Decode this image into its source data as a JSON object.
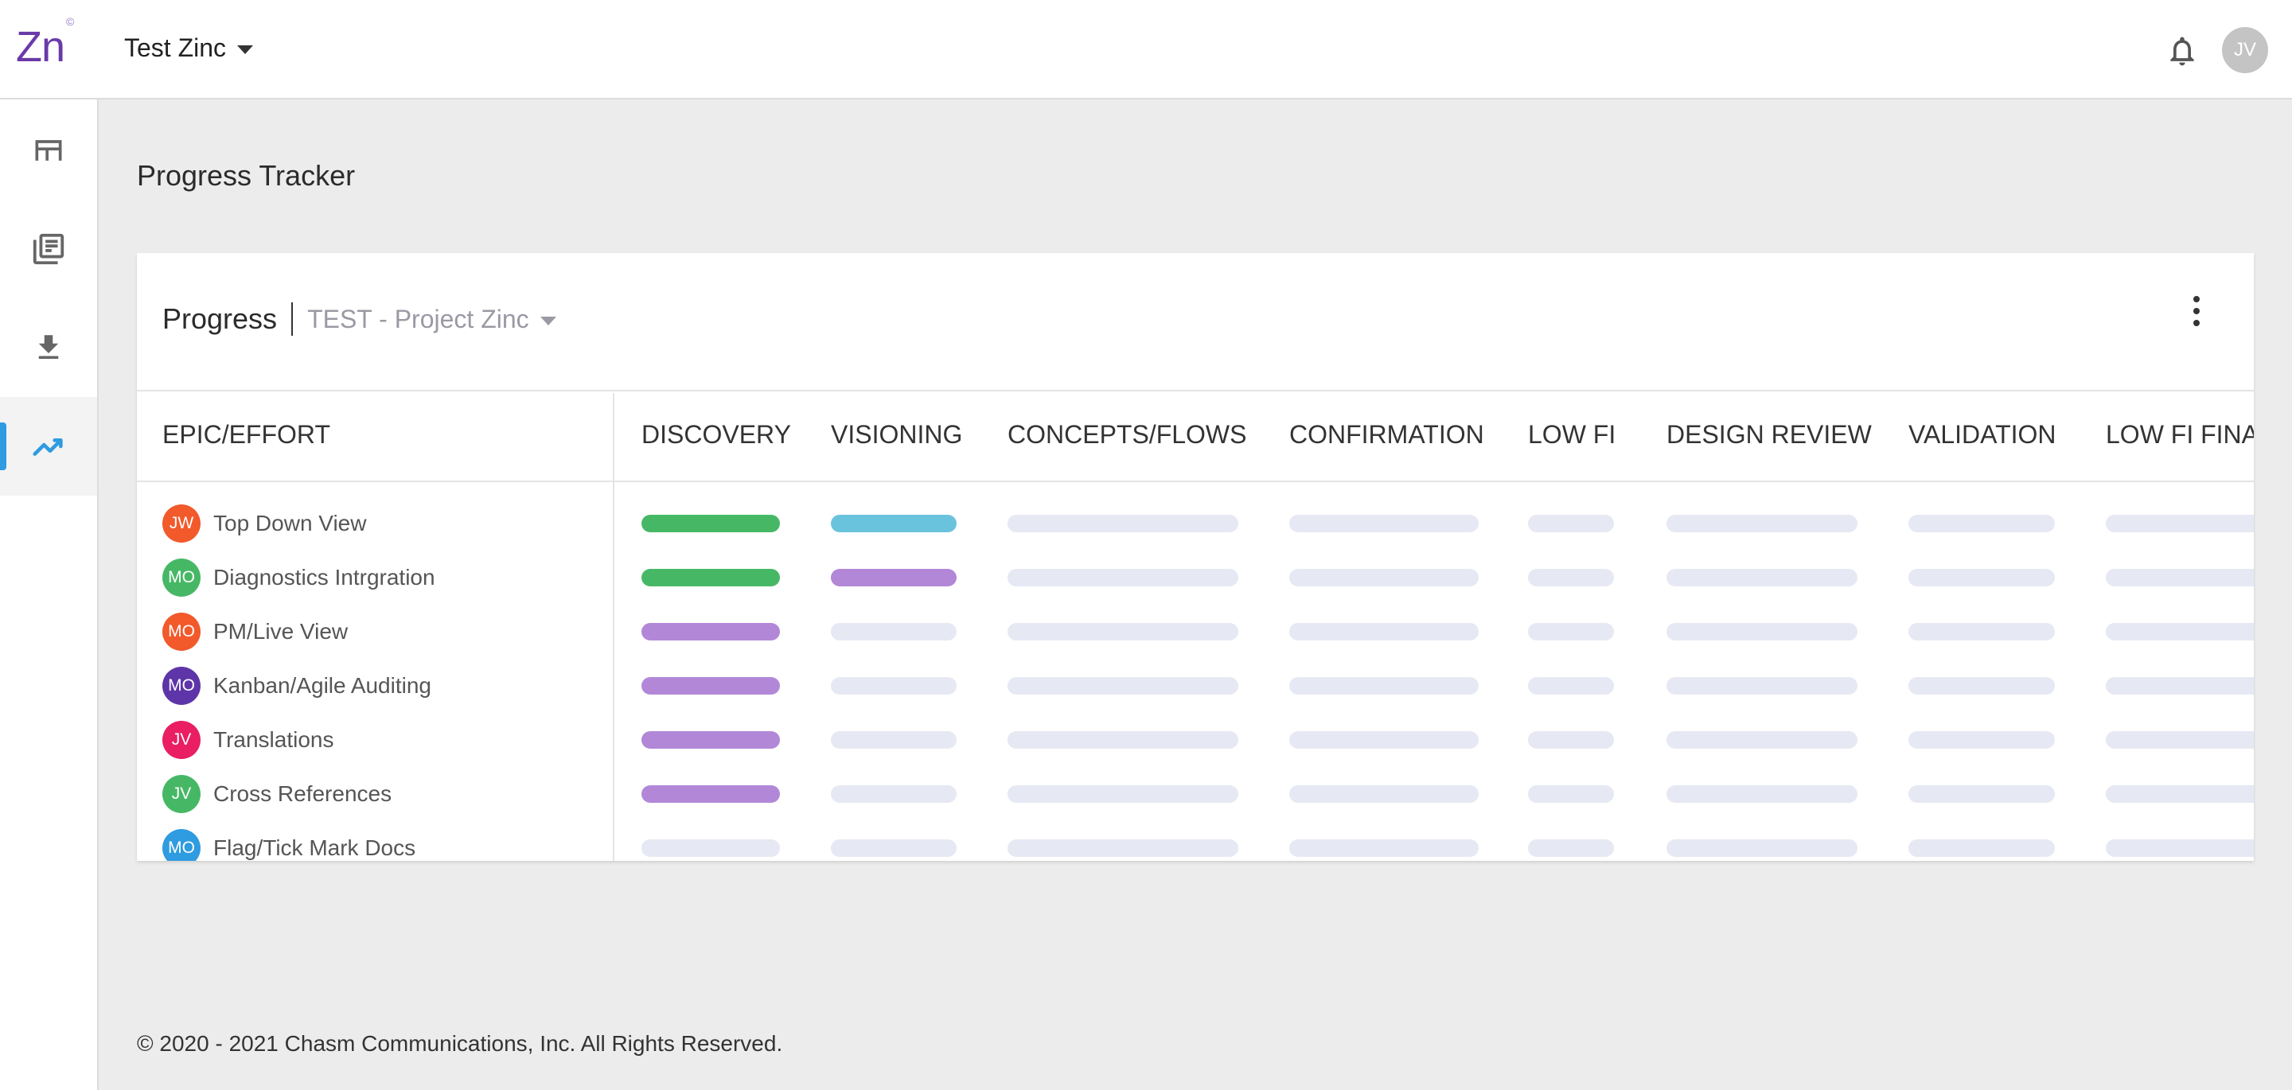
{
  "app": {
    "logo_text": "Zn",
    "logo_mark": "©",
    "org_name": "Test Zinc",
    "user_initials": "JV"
  },
  "sidebar": {
    "items": [
      {
        "icon": "dashboard-icon"
      },
      {
        "icon": "library-icon"
      },
      {
        "icon": "download-icon"
      },
      {
        "icon": "trending-icon",
        "active": true
      }
    ]
  },
  "page": {
    "title": "Progress Tracker",
    "footer": "© 2020 - 2021 Chasm Communications, Inc. All Rights Reserved."
  },
  "card": {
    "title": "Progress",
    "project": "TEST - Project Zinc",
    "first_column_header": "EPIC/EFFORT",
    "columns": [
      "DISCOVERY",
      "VISIONING",
      "CONCEPTS/FLOWS",
      "CONFIRMATION",
      "LOW FI",
      "DESIGN REVIEW",
      "VALIDATION",
      "LOW FI FINA"
    ]
  },
  "colors": {
    "green": "#46b865",
    "blue": "#6ac3dd",
    "purple": "#b287d8",
    "empty": "#e6e8f3",
    "accent": "#2f9be0",
    "brand": "#6a3aa8"
  },
  "rows": [
    {
      "initials": "JW",
      "avatar_color": "#f2592b",
      "name": "Top Down View",
      "stages": [
        "green",
        "blue",
        "empty",
        "empty",
        "empty",
        "empty",
        "empty",
        "empty"
      ]
    },
    {
      "initials": "MO",
      "avatar_color": "#46b865",
      "name": "Diagnostics Intrgration",
      "stages": [
        "green",
        "purple",
        "empty",
        "empty",
        "empty",
        "empty",
        "empty",
        "empty"
      ]
    },
    {
      "initials": "MO",
      "avatar_color": "#f2592b",
      "name": "PM/Live View",
      "stages": [
        "purple",
        "empty",
        "empty",
        "empty",
        "empty",
        "empty",
        "empty",
        "empty"
      ]
    },
    {
      "initials": "MO",
      "avatar_color": "#5e35a8",
      "name": "Kanban/Agile Auditing",
      "stages": [
        "purple",
        "empty",
        "empty",
        "empty",
        "empty",
        "empty",
        "empty",
        "empty"
      ]
    },
    {
      "initials": "JV",
      "avatar_color": "#e91e63",
      "name": "Translations",
      "stages": [
        "purple",
        "empty",
        "empty",
        "empty",
        "empty",
        "empty",
        "empty",
        "empty"
      ]
    },
    {
      "initials": "JV",
      "avatar_color": "#46b865",
      "name": "Cross References",
      "stages": [
        "purple",
        "empty",
        "empty",
        "empty",
        "empty",
        "empty",
        "empty",
        "empty"
      ]
    },
    {
      "initials": "MO",
      "avatar_color": "#2f9be0",
      "name": "Flag/Tick Mark Docs",
      "stages": [
        "empty",
        "empty",
        "empty",
        "empty",
        "empty",
        "empty",
        "empty",
        "empty"
      ]
    }
  ]
}
